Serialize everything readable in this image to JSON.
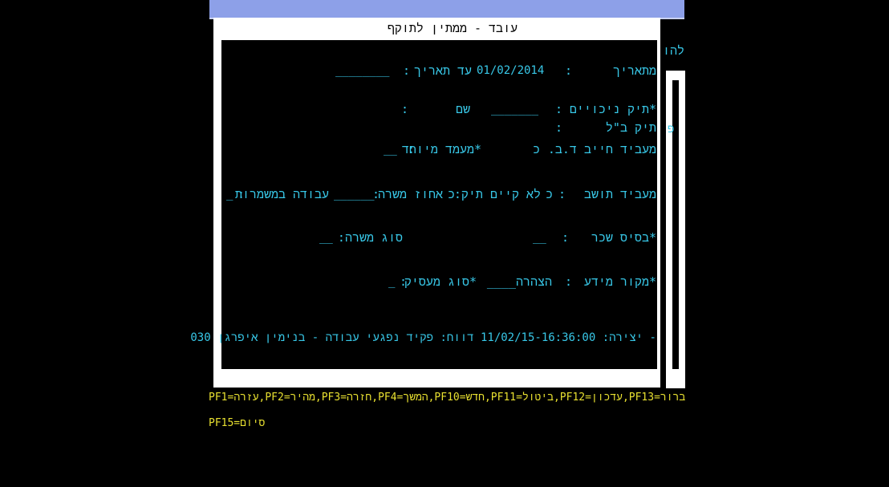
{
  "colors": {
    "background": "#000000",
    "text_cyan": "#38c8e8",
    "text_yellow": "#e8e030",
    "panel": "#ffffff",
    "topbar": "#8da0e8"
  },
  "header": {
    "title": "עובד - ממתין לתוקף"
  },
  "side": {
    "label_top": "להו",
    "label_mid": "פ"
  },
  "form": {
    "from_date_label": "מתאריך",
    "colon": ":",
    "from_date_value": "01/02/2014",
    "to_date_label": "עד תאריך",
    "to_date_value": "________",
    "deductions_file_label": "*תיק ניכויים",
    "deductions_file_value": "_______",
    "name_label": "שם",
    "nl_file_label": "תיק ב\"ל",
    "employer_liable_label": "מעביד חייב ד.ב.",
    "employer_liable_value": "כ",
    "special_status_label": "*מעמד מיוחד",
    "special_status_value": "__",
    "resident_employer_label": "מעביד תושב",
    "resident_employer_value": "כ",
    "no_file_label": "לא קיים תיק:",
    "no_file_value": "כ",
    "job_percent_label": "אחוז משרה",
    "job_percent_value": "______",
    "shift_work_label": "עבודה במשמרות",
    "shift_work_value": "_",
    "salary_base_label": "*בסיס שכר",
    "salary_base_value": "__",
    "job_type_label": "סוג משרה:",
    "job_type_value": "__",
    "info_source_label": "*מקור מידע",
    "info_source_value": "הצהרה____",
    "employer_type_label": "*סוג מעסיק",
    "employer_type_value": "_",
    "footer_line": "- יצירה: 11/02/15-16:36:00 דווח: פקיד נפגעי עבודה - בנימין איפרגן 030"
  },
  "function_keys": {
    "line1": "PF1=עזרה,PF2=מהיר,PF3=חזרה,PF4=המשך,PF10=חדש,PF11=ביטול,PF12=עדכון,PF13=ברור",
    "line2": "PF15=סיום"
  }
}
